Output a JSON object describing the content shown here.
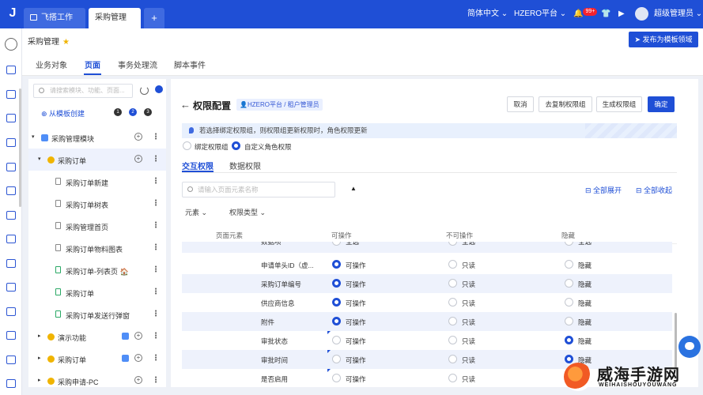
{
  "topbar": {
    "logo_glyph": "J",
    "tabs": [
      {
        "label": "飞搭工作台",
        "icon": "monitor-icon"
      },
      {
        "label": "采购管理",
        "close": "×"
      }
    ],
    "add_tab": "+",
    "language": "简体中文",
    "platform": "HZERO平台",
    "notification_badge": "99+",
    "user_name": "超级管理员"
  },
  "breadcrumb": {
    "title": "采购管理",
    "star": "★",
    "publish_button": "发布为模板领域"
  },
  "subtabs": [
    "业务对象",
    "页面",
    "事务处理流",
    "脚本事件"
  ],
  "tree": {
    "search_placeholder": "请搜索模块、功能、页面...",
    "from_template": "从模板创建",
    "steps": [
      "1",
      "2",
      "3"
    ],
    "rows": [
      {
        "label": "采购管理模块",
        "level": 0,
        "caret": "▾",
        "kind": "module",
        "plus": true
      },
      {
        "label": "采购订单",
        "level": 1,
        "caret": "▾",
        "kind": "function",
        "plus": true,
        "selected": true
      },
      {
        "label": "采购订单新建",
        "level": 2,
        "kind": "page"
      },
      {
        "label": "采购订单树表",
        "level": 2,
        "kind": "page"
      },
      {
        "label": "采购管理首页",
        "level": 2,
        "kind": "page"
      },
      {
        "label": "采购订单物料图表",
        "level": 2,
        "kind": "page"
      },
      {
        "label": "采购订单-列表页 🏠",
        "level": 2,
        "kind": "page-green"
      },
      {
        "label": "采购订单",
        "level": 2,
        "kind": "page-green"
      },
      {
        "label": "采购订单发送行弹窗",
        "level": 2,
        "kind": "page-green"
      },
      {
        "label": "演示功能",
        "level": 1,
        "caret": "▸",
        "kind": "function",
        "plus": true,
        "chip": true
      },
      {
        "label": "采购订单",
        "level": 1,
        "caret": "▸",
        "kind": "function",
        "plus": true,
        "chip": true
      },
      {
        "label": "采购申请-PC",
        "level": 1,
        "caret": "▸",
        "kind": "function",
        "plus": true
      }
    ]
  },
  "panel": {
    "back_arrow": "←",
    "title": "权限配置",
    "crumb": "HZERO平台 / 租户管理员",
    "buttons": [
      "取消",
      "去复制权限组",
      "生成权限组",
      "确定"
    ],
    "notice": "若选择绑定权限组，则权限组更新权限时，角色权限更新",
    "mode_options": [
      "绑定权限组",
      "自定义角色权限"
    ],
    "mode_selected": 1,
    "tabs": [
      "交互权限",
      "数据权限"
    ],
    "element_search_placeholder": "请输入页面元素名称",
    "up_arrow": "▲",
    "expand_all": "全部展开",
    "collapse_all": "全部收起",
    "filters": [
      "元素",
      "权限类型"
    ],
    "columns": [
      "页面元素",
      "可操作",
      "不可操作",
      "隐藏"
    ],
    "rows": [
      {
        "name": "数据项",
        "c2": "全选",
        "c3": "全选",
        "c4": "全选",
        "sel": 0,
        "partial": true
      },
      {
        "name": "申请单头ID（虚...",
        "c2": "可操作",
        "c3": "只读",
        "c4": "隐藏",
        "sel": 1
      },
      {
        "name": "采购订单编号",
        "c2": "可操作",
        "c3": "只读",
        "c4": "隐藏",
        "sel": 1
      },
      {
        "name": "供应商信息",
        "c2": "可操作",
        "c3": "只读",
        "c4": "隐藏",
        "sel": 1
      },
      {
        "name": "附件",
        "c2": "可操作",
        "c3": "只读",
        "c4": "隐藏",
        "sel": 1
      },
      {
        "name": "审批状态",
        "c2": "可操作",
        "c3": "只读",
        "c4": "隐藏",
        "sel": 3,
        "flag": true
      },
      {
        "name": "审批时间",
        "c2": "可操作",
        "c3": "只读",
        "c4": "隐藏",
        "sel": 3,
        "flag": true
      },
      {
        "name": "是否启用",
        "c2": "可操作",
        "c3": "只读",
        "c4": "隐藏",
        "sel": 0,
        "flag": true
      }
    ]
  },
  "watermark": {
    "main": "威海手游网",
    "sub": "WEIHAISHOUYOUWANG"
  },
  "colors": {
    "primary": "#1f4fd6",
    "selected_row": "#eef2fd",
    "notice_bg": "#e8f0fd"
  }
}
